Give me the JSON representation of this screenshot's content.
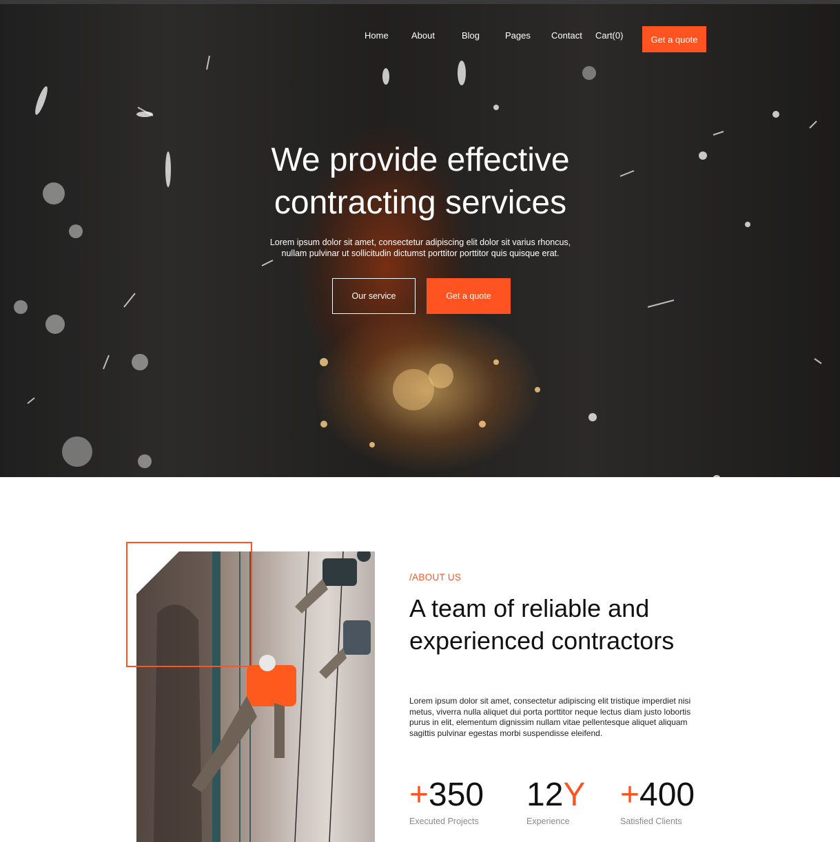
{
  "nav": {
    "items": [
      {
        "label": "Home"
      },
      {
        "label": "About"
      },
      {
        "label": "Blog"
      },
      {
        "label": "Pages"
      },
      {
        "label": "Contact"
      },
      {
        "label": "Cart(0)"
      }
    ],
    "cta_label": "Get a quote"
  },
  "hero": {
    "title": "We provide effective contracting services",
    "lead": "Lorem ipsum dolor sit amet, consectetur adipiscing elit dolor sit varius rhoncus, nullam pulvinar ut sollicitudin dictumst porttitor porttitor quis quisque erat.",
    "btn_outline": "Our service",
    "btn_solid": "Get a quote"
  },
  "about": {
    "eyebrow": "/ABOUT US",
    "title": "A team of reliable and experienced contractors",
    "text": "Lorem ipsum dolor sit amet, consectetur adipiscing elit tristique imperdiet nisi metus, viverra nulla aliquet dui porta porttitor neque lectus diam justo lobortis purus in elit, elementum dignissim nullam vitae pellentesque aliquet aliquam sagittis pulvinar egestas morbi suspendisse eleifend.",
    "stats": [
      {
        "prefix": "+",
        "value": "350",
        "suffix": "",
        "label": "Executed Projects"
      },
      {
        "prefix": "",
        "value": "12",
        "suffix": "Y",
        "label": "Experience"
      },
      {
        "prefix": "+",
        "value": "400",
        "suffix": "",
        "label": "Satisfied Clients"
      }
    ]
  },
  "colors": {
    "accent": "#ff5421",
    "hero_dark": "#2a2a2a",
    "text": "#111111",
    "muted": "#8a8a8a"
  }
}
